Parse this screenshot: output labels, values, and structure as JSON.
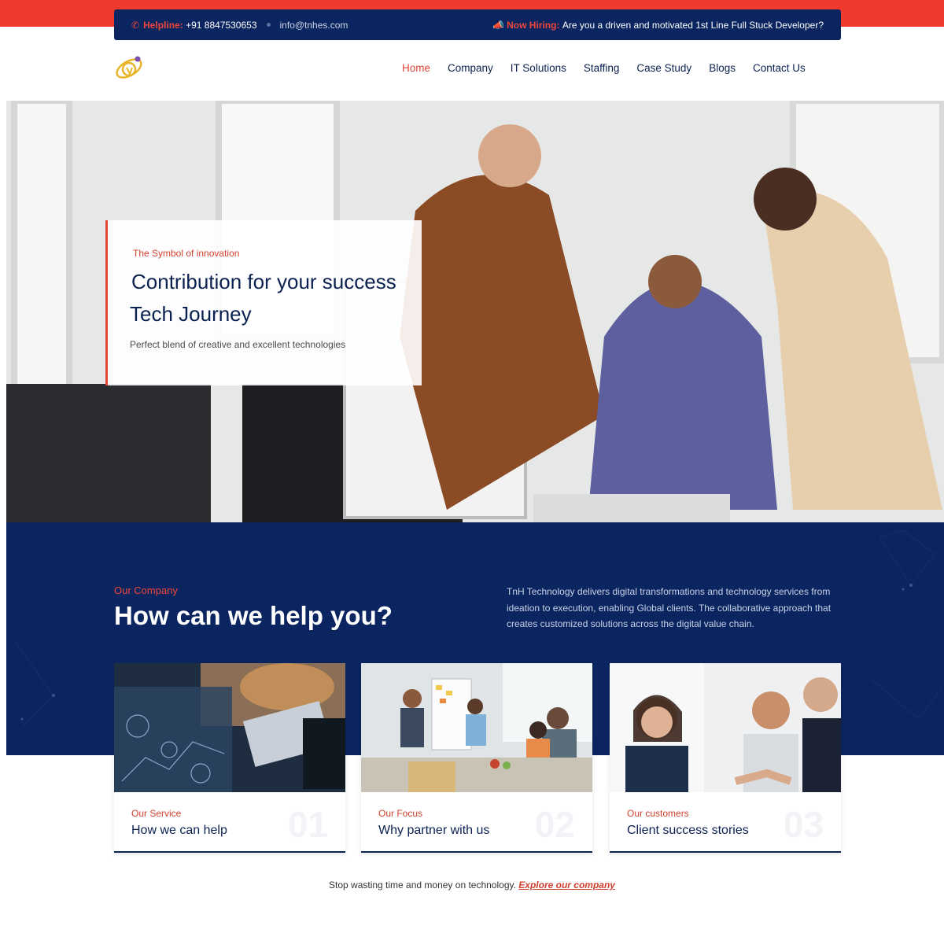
{
  "topbar": {
    "helpline_label": "Helpline:",
    "helpline_number": "+91 8847530653",
    "email": "info@tnhes.com",
    "hiring_label": "Now Hiring:",
    "hiring_text": "Are you a driven and motivated 1st Line Full Stuck Developer?"
  },
  "nav": {
    "items": [
      "Home",
      "Company",
      "IT Solutions",
      "Staffing",
      "Case Study",
      "Blogs",
      "Contact Us"
    ],
    "active": "Home"
  },
  "hero": {
    "kicker": "The Symbol of innovation",
    "title_line1": "Contribution for your success",
    "title_line2": "Tech Journey",
    "subtitle": "Perfect blend of creative and excellent technologies"
  },
  "company": {
    "kicker": "Our Company",
    "heading": "How can we help you?",
    "description": "TnH Technology delivers digital transformations and technology services from ideation to execution, enabling Global clients. The collaborative approach that creates customized solutions across the digital value chain."
  },
  "cards": [
    {
      "kicker": "Our Service",
      "title": "How we can help",
      "number": "01"
    },
    {
      "kicker": "Our Focus",
      "title": "Why partner with us",
      "number": "02"
    },
    {
      "kicker": "Our customers",
      "title": "Client success stories",
      "number": "03"
    }
  ],
  "footer": {
    "text": "Stop wasting time and money on technology.",
    "link": "Explore our company"
  },
  "colors": {
    "accent_red": "#f03a2e",
    "navy": "#0b2560"
  }
}
